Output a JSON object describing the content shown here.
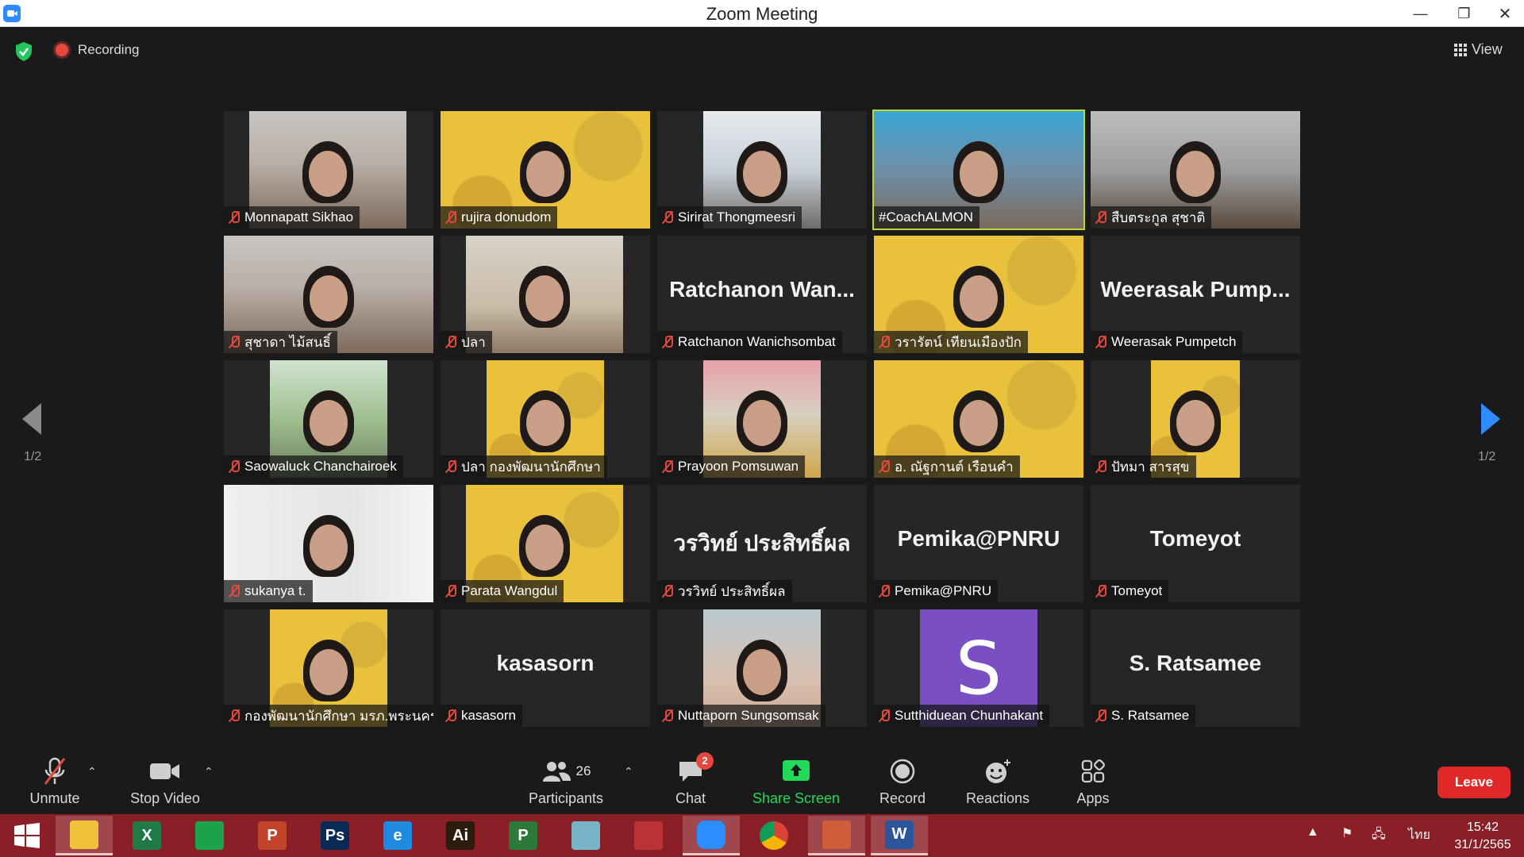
{
  "window": {
    "title": "Zoom Meeting"
  },
  "top_bar": {
    "recording_label": "Recording",
    "view_label": "View"
  },
  "pagination": {
    "left": "1/2",
    "right": "1/2"
  },
  "participants": [
    {
      "display_name": "Monnapatt Sikhao",
      "muted": true,
      "video": "photo-person"
    },
    {
      "display_name": "rujira donudom",
      "muted": true,
      "video": "photo-yellow"
    },
    {
      "display_name": "Sirirat Thongmeesri",
      "muted": true,
      "video": "photo-snow"
    },
    {
      "display_name": "#CoachALMON",
      "muted": false,
      "video": "photo-coach",
      "active_speaker": true
    },
    {
      "display_name": "สืบตระกูล สุชาติ",
      "muted": true,
      "video": "photo-man"
    },
    {
      "display_name": "สุชาดา ไม้สนธิ์",
      "muted": true,
      "video": "photo-person"
    },
    {
      "display_name": "ปลา",
      "muted": true,
      "video": "photo-office"
    },
    {
      "display_name": "Ratchanon Wanichsombat",
      "muted": true,
      "video": null,
      "tile_name": "Ratchanon  Wan..."
    },
    {
      "display_name": "วรารัตน์ เทียนเมืองปัก",
      "muted": true,
      "video": "photo-yellow"
    },
    {
      "display_name": "Weerasak Pumpetch",
      "muted": true,
      "video": null,
      "tile_name": "Weerasak  Pump..."
    },
    {
      "display_name": "Saowaluck Chanchairoek",
      "muted": true,
      "video": "photo-green"
    },
    {
      "display_name": "ปลา กองพัฒนานักศึกษา",
      "muted": true,
      "video": "photo-yellow"
    },
    {
      "display_name": "Prayoon Pomsuwan",
      "muted": true,
      "video": "photo-stage"
    },
    {
      "display_name": "อ. ณัฐกานต์ เรือนคำ",
      "muted": true,
      "video": "photo-yellow"
    },
    {
      "display_name": "ปัทมา สารสุข",
      "muted": true,
      "video": "photo-yellow"
    },
    {
      "display_name": "sukanya t.",
      "muted": true,
      "video": "photo-plant"
    },
    {
      "display_name": "Parata Wangdul",
      "muted": true,
      "video": "photo-yellow"
    },
    {
      "display_name": "วรวิทย์ ประสิทธิ์ผล",
      "muted": true,
      "video": null,
      "tile_name": "วรวิทย์ ประสิทธิ์ผล"
    },
    {
      "display_name": "Pemika@PNRU",
      "muted": true,
      "video": null,
      "tile_name": "Pemika@PNRU"
    },
    {
      "display_name": "Tomeyot",
      "muted": true,
      "video": null,
      "tile_name": "Tomeyot"
    },
    {
      "display_name": "กองพัฒนานักศึกษา มรภ.พระนคร",
      "muted": true,
      "video": "photo-yellow"
    },
    {
      "display_name": "kasasorn",
      "muted": true,
      "video": null,
      "tile_name": "kasasorn"
    },
    {
      "display_name": "Nuttaporn Sungsomsak",
      "muted": true,
      "video": "photo-selfie"
    },
    {
      "display_name": "Sutthiduean Chunhakant",
      "muted": true,
      "video": "photo-purple",
      "avatar_letter": "S"
    },
    {
      "display_name": "S. Ratsamee",
      "muted": true,
      "video": null,
      "tile_name": "S. Ratsamee"
    }
  ],
  "toolbar": {
    "unmute": "Unmute",
    "stop_video": "Stop Video",
    "participants": "Participants",
    "participants_count": "26",
    "chat": "Chat",
    "chat_badge": "2",
    "share_screen": "Share Screen",
    "record": "Record",
    "reactions": "Reactions",
    "apps": "Apps",
    "leave": "Leave"
  },
  "taskbar": {
    "language": "ไทย",
    "time": "15:42",
    "date": "31/1/2565",
    "apps": [
      {
        "name": "file-explorer",
        "glyph": "",
        "color": "#f0c23c"
      },
      {
        "name": "excel",
        "glyph": "X",
        "color": "#1f7a45"
      },
      {
        "name": "store",
        "glyph": "",
        "color": "#1aa34a"
      },
      {
        "name": "powerpoint",
        "glyph": "P",
        "color": "#c4432b"
      },
      {
        "name": "photoshop",
        "glyph": "Ps",
        "color": "#0a2a56"
      },
      {
        "name": "internet-explorer",
        "glyph": "e",
        "color": "#1f8be0"
      },
      {
        "name": "illustrator",
        "glyph": "Ai",
        "color": "#2b1c0e"
      },
      {
        "name": "project",
        "glyph": "P",
        "color": "#2b7a39"
      },
      {
        "name": "notes",
        "glyph": "",
        "color": "#79b3c8"
      },
      {
        "name": "photoscape",
        "glyph": "",
        "color": "#b33"
      },
      {
        "name": "zoom",
        "glyph": "",
        "color": "#2d8cff"
      },
      {
        "name": "chrome",
        "glyph": "",
        "color": "#e8e8e8"
      },
      {
        "name": "powerpoint-viewer",
        "glyph": "",
        "color": "#d15c3c"
      },
      {
        "name": "word",
        "glyph": "W",
        "color": "#2b579a"
      }
    ]
  }
}
